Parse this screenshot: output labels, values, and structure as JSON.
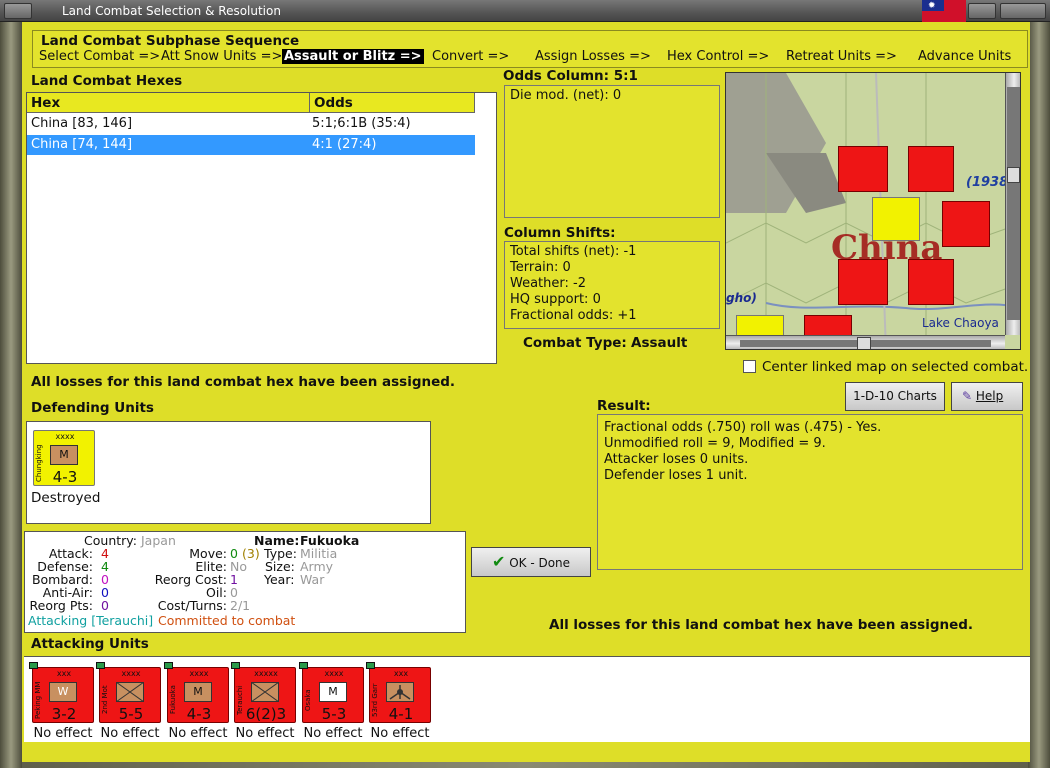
{
  "window": {
    "title": "Land Combat Selection & Resolution"
  },
  "phase": {
    "title": "Land Combat Subphase Sequence",
    "steps": [
      "Select Combat =>",
      "Att Snow Units =>",
      "Assault or Blitz =>",
      "Convert =>",
      "Assign Losses =>",
      "Hex Control =>",
      "Retreat Units =>",
      "Advance Units"
    ],
    "active_step": "Assault or Blitz =>"
  },
  "hexes": {
    "title": "Land Combat Hexes",
    "columns": [
      "Hex",
      "Odds"
    ],
    "rows": [
      {
        "hex": "China [83, 146]",
        "odds": "5:1;6:1B (35:4)"
      },
      {
        "hex": "China [74, 144]",
        "odds": "4:1 (27:4)"
      }
    ]
  },
  "odds": {
    "title": "Odds Column: 5:1",
    "die_mod": "Die mod. (net): 0"
  },
  "shifts": {
    "title": "Column Shifts:",
    "lines": [
      "Total shifts (net): -1",
      "Terrain: 0",
      "Weather: -2",
      "HQ support: 0",
      "Fractional odds: +1"
    ]
  },
  "combat_type": {
    "label": "Combat Type:",
    "value": "Assault"
  },
  "map": {
    "labels": [
      "China",
      "(1938)",
      "Lake Chaoya",
      "gho)"
    ],
    "center_checkbox_label": "Center linked map on selected combat.",
    "center_checked": false
  },
  "buttons": {
    "charts": "1-D-10 Charts",
    "help": "Help",
    "done": "OK - Done"
  },
  "losses_msg": "All losses for this land combat hex have been assigned.",
  "defending": {
    "title": "Defending Units",
    "unit": {
      "name": "Chungking",
      "size": "xxxx",
      "type": "M",
      "strength": "4-3",
      "status": "Destroyed"
    }
  },
  "result": {
    "title": "Result:",
    "lines": [
      "Fractional odds (.750) roll was (.475)  - Yes.",
      "Unmodified roll = 9, Modified = 9.",
      "Attacker loses 0 units.",
      "Defender loses 1 unit."
    ]
  },
  "info": {
    "country_label": "Country:",
    "country": "Japan",
    "attack_label": "Attack:",
    "attack": "4",
    "defense_label": "Defense:",
    "defense": "4",
    "bombard_label": "Bombard:",
    "bombard": "0",
    "antiair_label": "Anti-Air:",
    "antiair": "0",
    "reorg_pts_label": "Reorg Pts:",
    "reorg_pts": "0",
    "name_label": "Name:",
    "name": "Fukuoka",
    "move_label": "Move:",
    "move": "0",
    "move_extra": "(3)",
    "type_label": "Type:",
    "type": "Militia",
    "elite_label": "Elite:",
    "elite": "No",
    "size_label": "Size:",
    "size": "Army",
    "reorg_cost_label": "Reorg Cost:",
    "reorg_cost": "1",
    "year_label": "Year:",
    "year": "War",
    "oil_label": "Oil:",
    "oil": "0",
    "cost_turns_label": "Cost/Turns:",
    "cost_turns": "2/1",
    "attacking": "Attacking [Terauchi]",
    "committed": "Committed to combat"
  },
  "attacking": {
    "title": "Attacking Units",
    "units": [
      {
        "name": "Peking MM",
        "size": "xxx",
        "type": "W",
        "strength": "3-2",
        "status": "No effect"
      },
      {
        "name": "2nd Mot",
        "size": "xxxx",
        "type": "X",
        "strength": "5-5",
        "status": "No effect"
      },
      {
        "name": "Fukuoka",
        "size": "xxxx",
        "type": "M",
        "strength": "4-3",
        "status": "No effect"
      },
      {
        "name": "Terauchi",
        "size": "xxxxx",
        "type": "X",
        "strength": "6(2)3",
        "status": "No effect"
      },
      {
        "name": "Osaka",
        "size": "xxxx",
        "type": "M",
        "strength": "5-3",
        "status": "No effect",
        "reserve": "R"
      },
      {
        "name": "53rd Garr",
        "size": "xxx",
        "type": "G",
        "strength": "4-1",
        "status": "No effect",
        "reserve": "R"
      }
    ]
  },
  "colors": {
    "panel": "#e3e32d",
    "unit_red": "#ee1515",
    "selection": "#3399ff",
    "defender_yellow": "#f2f200"
  }
}
